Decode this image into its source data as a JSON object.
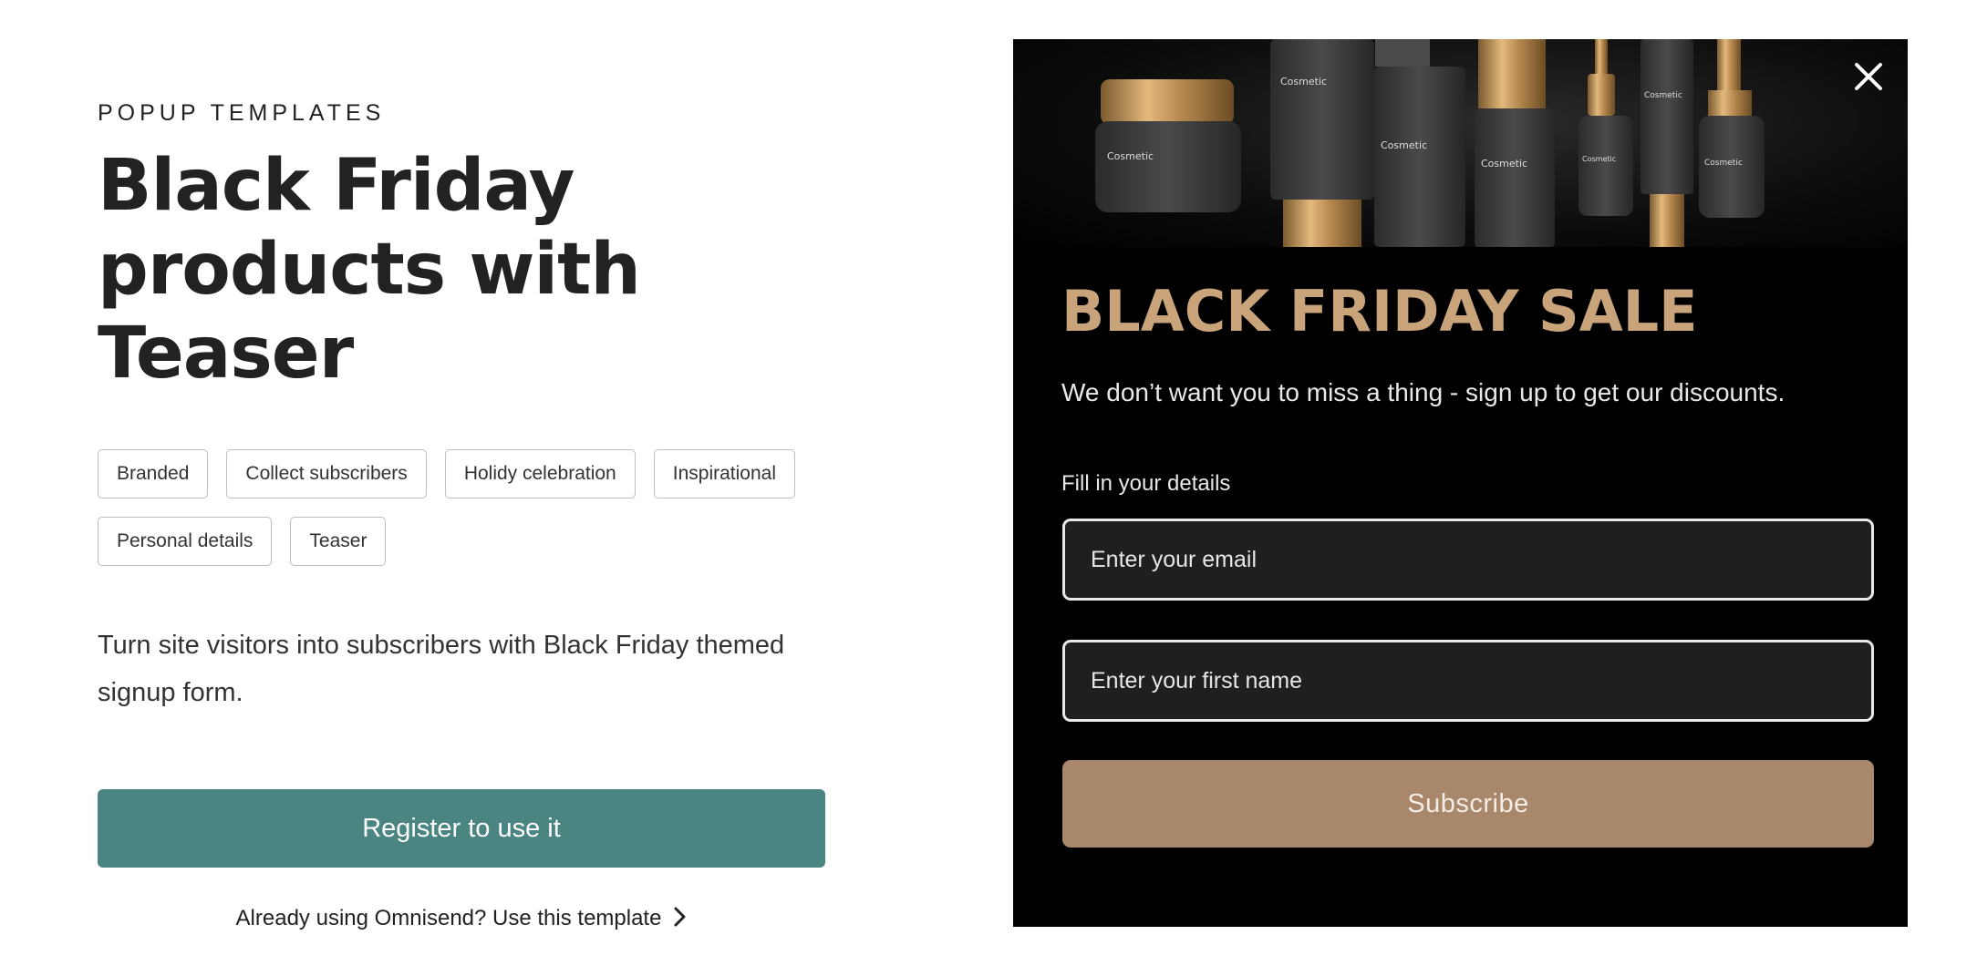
{
  "hero": {
    "eyebrow": "POPUP TEMPLATES",
    "title": "Black Friday products with Teaser",
    "tags": [
      "Branded",
      "Collect subscribers",
      "Holidy celebration",
      "Inspirational",
      "Personal details",
      "Teaser"
    ],
    "description": "Turn site visitors into subscribers with Black Friday themed signup form.",
    "cta_label": "Register to use it",
    "secondary_link": "Already using Omnisend? Use this template"
  },
  "popup": {
    "product_label": "Cosmetic",
    "heading": "BLACK FRIDAY SALE",
    "subheading": "We don’t want you to miss a thing - sign up to get our discounts.",
    "form_label": "Fill in your details",
    "email_placeholder": "Enter your email",
    "first_name_placeholder": "Enter your first name",
    "submit_label": "Subscribe"
  },
  "colors": {
    "accent": "#4a8581",
    "gold": "#c9a47b",
    "button_bronze": "#a8876a",
    "popup_bg": "#000000"
  },
  "icons": {
    "close": "close-icon",
    "chevron": "chevron-right-icon"
  }
}
